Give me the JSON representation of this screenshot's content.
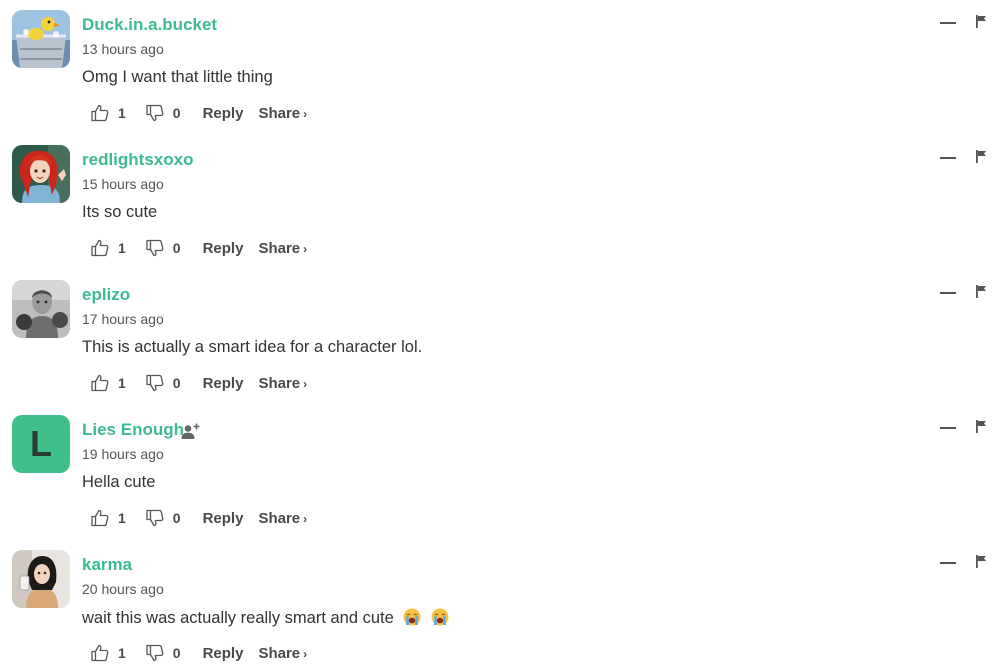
{
  "comments": [
    {
      "username": "Duck.in.a.bucket",
      "time": "13 hours ago",
      "text": "Omg I want that little thing",
      "likes": "1",
      "dislikes": "0",
      "avatar": "duck-in-bucket-icon"
    },
    {
      "username": "redlightsxoxo",
      "time": "15 hours ago",
      "text": "Its so cute",
      "likes": "1",
      "dislikes": "0",
      "avatar": "red-hair-character-icon"
    },
    {
      "username": "eplizo",
      "time": "17 hours ago",
      "text": "This is actually a smart idea for a character lol.",
      "likes": "1",
      "dislikes": "0",
      "avatar": "boxer-photo-icon"
    },
    {
      "username": "Lies Enough",
      "time": "19 hours ago",
      "text": "Hella cute",
      "likes": "1",
      "dislikes": "0",
      "avatar_letter": "L",
      "avatar": "letter-avatar"
    },
    {
      "username": "karma",
      "time": "20 hours ago",
      "text": "wait this was actually really smart and cute",
      "emojis": [
        "loudly-crying-face-icon",
        "loudly-crying-face-icon"
      ],
      "likes": "1",
      "dislikes": "0",
      "avatar": "person-photo-icon"
    }
  ],
  "labels": {
    "reply": "Reply",
    "share": "Share",
    "share_chevron": "›"
  },
  "colors": {
    "username": "#3dbb8e",
    "letter_avatar_bg": "#3fbf8a",
    "text": "#333333",
    "meta": "#555555"
  }
}
